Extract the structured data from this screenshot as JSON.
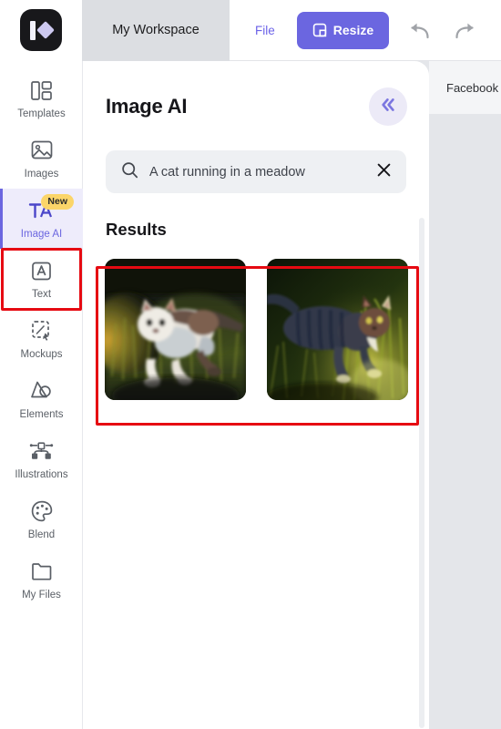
{
  "app": {
    "logo_name": "app-logo",
    "accent": "#6b66e0",
    "annotation_color": "#e60a12"
  },
  "topbar": {
    "workspace_tab": "My Workspace",
    "file_label": "File",
    "resize_label": "Resize",
    "undo_label": "Undo",
    "redo_label": "Redo"
  },
  "sidebar": {
    "items": [
      {
        "label": "Templates",
        "icon": "templates-icon",
        "active": false,
        "badge": ""
      },
      {
        "label": "Images",
        "icon": "images-icon",
        "active": false,
        "badge": ""
      },
      {
        "label": "Image AI",
        "icon": "image-ai-icon",
        "active": true,
        "badge": "New"
      },
      {
        "label": "Text",
        "icon": "text-icon",
        "active": false,
        "badge": ""
      },
      {
        "label": "Mockups",
        "icon": "mockups-icon",
        "active": false,
        "badge": ""
      },
      {
        "label": "Elements",
        "icon": "elements-icon",
        "active": false,
        "badge": ""
      },
      {
        "label": "Illustrations",
        "icon": "illustrations-icon",
        "active": false,
        "badge": ""
      },
      {
        "label": "Blend",
        "icon": "blend-icon",
        "active": false,
        "badge": ""
      },
      {
        "label": "My Files",
        "icon": "my-files-icon",
        "active": false,
        "badge": ""
      }
    ]
  },
  "panel": {
    "title": "Image AI",
    "collapse_label": "Collapse panel",
    "search": {
      "value": "A cat running in a meadow",
      "placeholder": "Describe the image you want",
      "clear_label": "Clear"
    },
    "results_title": "Results",
    "results": [
      {
        "alt": "Calico cat running through a sunlit meadow"
      },
      {
        "alt": "Gray tabby cat walking through tall dark grass"
      }
    ]
  },
  "canvas": {
    "tab_label": "Facebook"
  }
}
